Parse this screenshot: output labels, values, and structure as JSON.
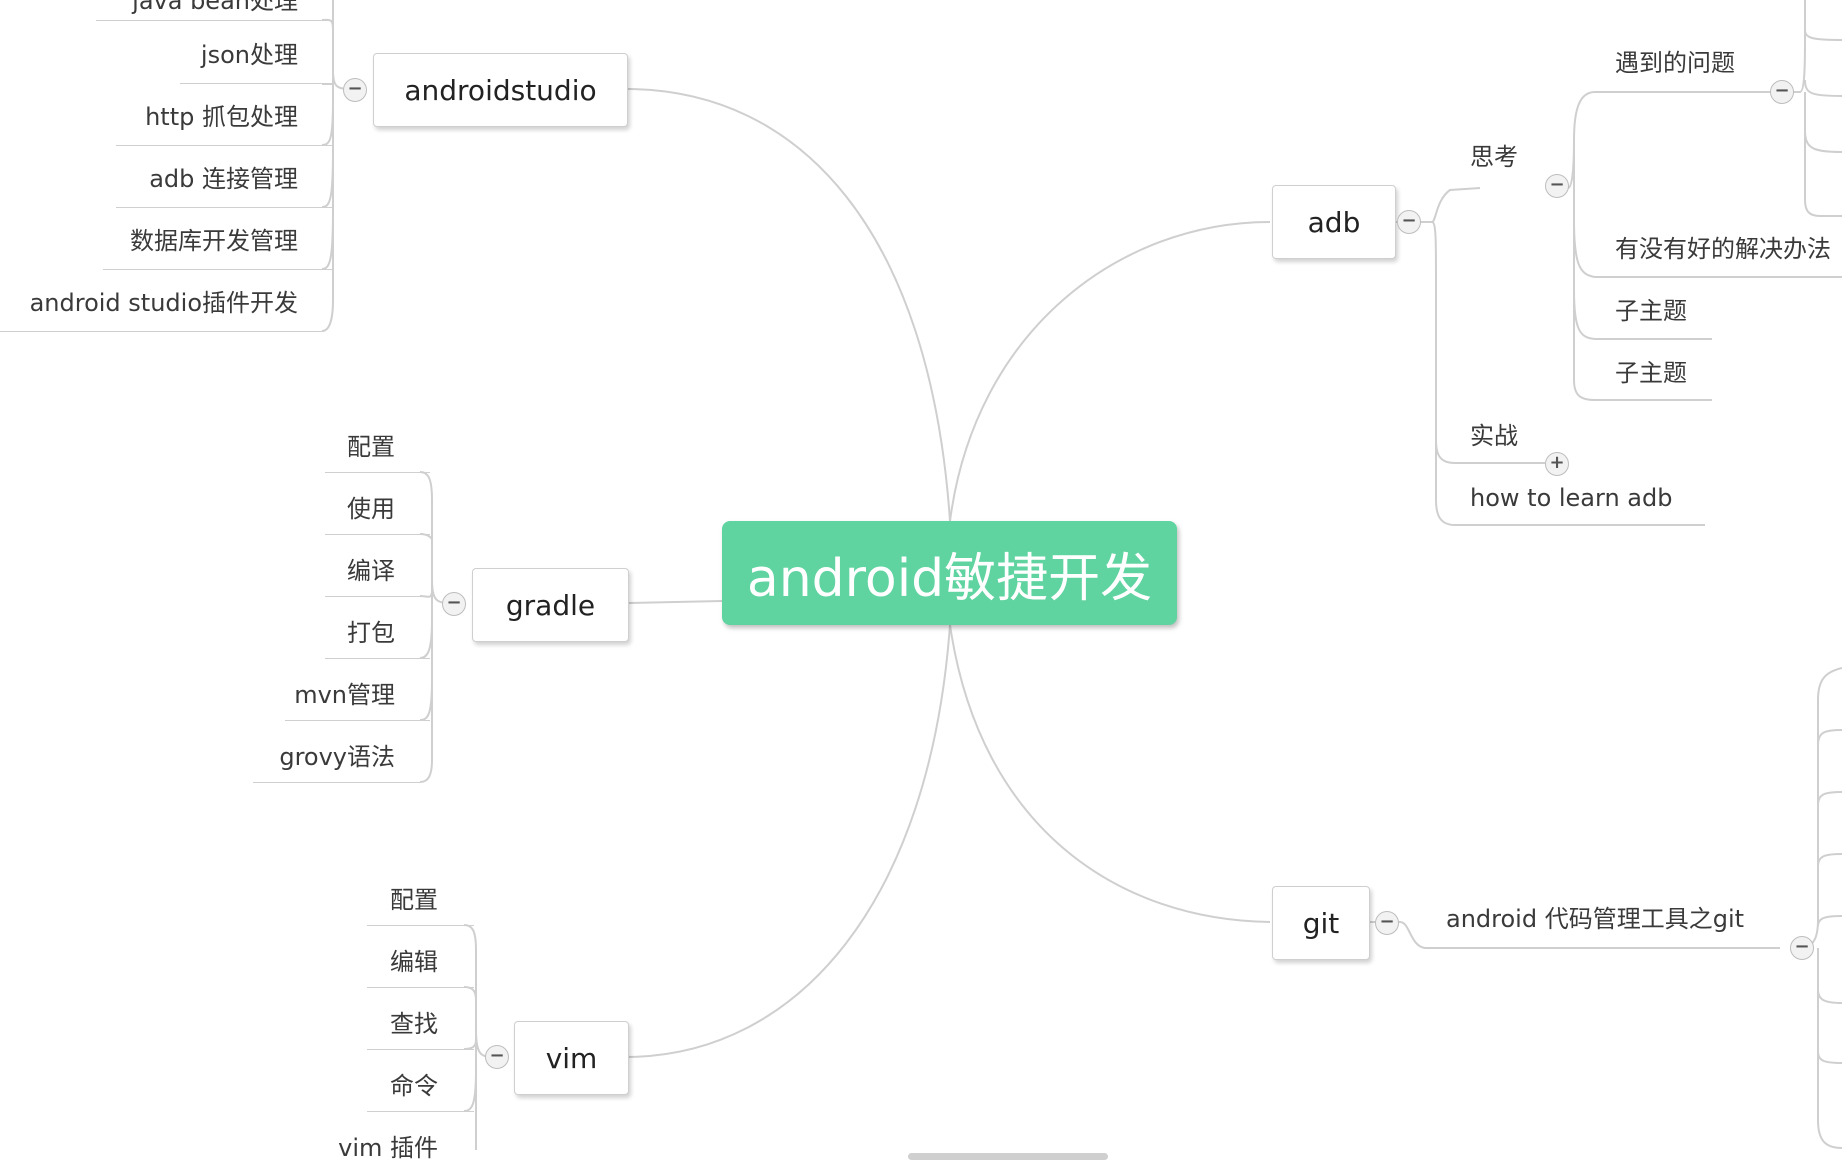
{
  "root": {
    "label": "android敏捷开发"
  },
  "branches": {
    "androidstudio": {
      "label": "androidstudio",
      "children": [
        "java bean处理",
        "json处理",
        "http 抓包处理",
        "adb 连接管理",
        "数据库开发管理",
        "android studio插件开发"
      ]
    },
    "gradle": {
      "label": "gradle",
      "children": [
        "配置",
        "使用",
        "编译",
        "打包",
        "mvn管理",
        "grovy语法"
      ]
    },
    "vim": {
      "label": "vim",
      "children": [
        "配置",
        "编辑",
        "查找",
        "命令",
        "vim 插件"
      ]
    },
    "adb": {
      "label": "adb",
      "thinking": {
        "label": "思考",
        "problems": "遇到的问题",
        "solutions": "有没有好的解决办法",
        "subtopic1": "子主题",
        "subtopic2": "子主题"
      },
      "practice": "实战",
      "learn": "how to learn adb"
    },
    "git": {
      "label": "git",
      "child": "android 代码管理工具之git"
    }
  },
  "toggles": {
    "collapse": "−",
    "expand": "+"
  },
  "colors": {
    "root_fill": "#5fd3a0",
    "connector": "#cfcfcf"
  }
}
